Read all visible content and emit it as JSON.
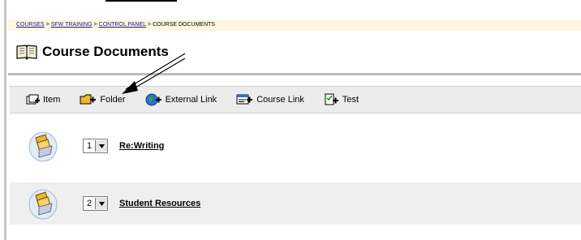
{
  "breadcrumb": {
    "items": [
      {
        "label": "COURSES"
      },
      {
        "label": "SFW TRAINING"
      },
      {
        "label": "CONTROL PANEL"
      }
    ],
    "current": "COURSE DOCUMENTS",
    "separator": ">"
  },
  "page": {
    "title": "Course Documents"
  },
  "toolbar": {
    "items": [
      {
        "label": "Item",
        "icon": "item-add-icon"
      },
      {
        "label": "Folder",
        "icon": "folder-add-icon"
      },
      {
        "label": "External Link",
        "icon": "globe-add-icon"
      },
      {
        "label": "Course Link",
        "icon": "course-link-add-icon"
      },
      {
        "label": "Test",
        "icon": "test-add-icon"
      }
    ]
  },
  "content": {
    "rows": [
      {
        "order": "1",
        "title": "Re:Writing",
        "icon": "folder-icon"
      },
      {
        "order": "2",
        "title": "Student Resources",
        "icon": "folder-icon"
      }
    ]
  },
  "colors": {
    "breadcrumb_bg": "#fdf7e2",
    "toolbar_bg": "#ececec",
    "alt_row_bg": "#efefef",
    "link": "#1a1a8a"
  }
}
